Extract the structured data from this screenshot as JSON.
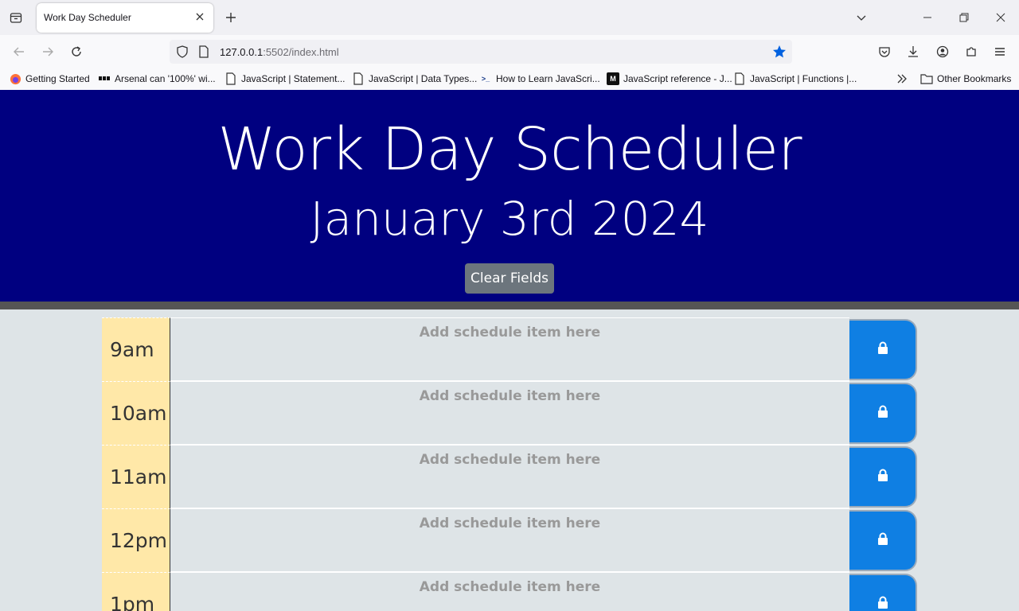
{
  "browser": {
    "tab_title": "Work Day Scheduler",
    "url_host": "127.0.0.1",
    "url_rest": ":5502/index.html",
    "bookmarks": [
      "Getting Started",
      "Arsenal can '100%' wi...",
      "JavaScript | Statement...",
      "JavaScript | Data Types...",
      "How to Learn JavaScri...",
      "JavaScript reference - J...",
      "JavaScript | Functions |...",
      "Other Bookmarks"
    ]
  },
  "header": {
    "title": "Work Day Scheduler",
    "date": "January 3rd 2024",
    "clear_label": "Clear Fields"
  },
  "schedule": {
    "placeholder": "Add schedule item here",
    "hours": [
      "9am",
      "10am",
      "11am",
      "12pm",
      "1pm"
    ]
  },
  "colors": {
    "header_bg": "#000080",
    "hour_bg": "#ffe8a8",
    "save_bg": "#0f7fe3"
  }
}
